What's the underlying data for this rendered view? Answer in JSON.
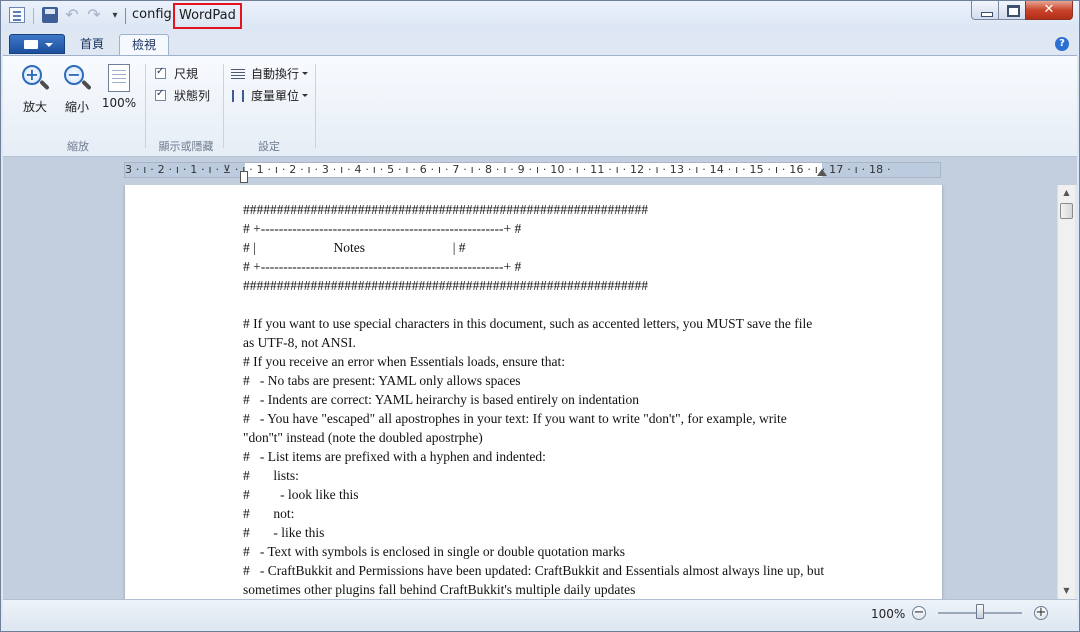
{
  "titlebar": {
    "document_name": "config",
    "app_name": "WordPad",
    "qa_dropdown_glyph": "▾",
    "undo_glyph": "↶",
    "redo_glyph": "↷",
    "close_glyph": "✕"
  },
  "tabs": {
    "home": "首頁",
    "view": "檢視",
    "help": "?"
  },
  "ribbon": {
    "zoom_group": {
      "zoom_in_label": "放大",
      "zoom_out_label": "縮小",
      "zoom_100_label": "100%",
      "group_label": "縮放"
    },
    "show_hide_group": {
      "ruler_label": "尺規",
      "ruler_checked": true,
      "statusbar_label": "狀態列",
      "statusbar_checked": true,
      "group_label": "顯示或隱藏"
    },
    "settings_group": {
      "word_wrap_label": "自動換行",
      "measure_units_label": "度量單位",
      "group_label": "設定"
    }
  },
  "ruler": {
    "numbers": "3 · ı · 2 · ı · 1 · ı · ⊻ · ı · 1 · ı · 2 · ı · 3 · ı · 4 · ı · 5 · ı · 6 · ı · 7 · ı · 8 · ı · 9 · ı · 10 · ı · 11 · ı · 12 · ı · 13 · ı · 14 · ı · 15 · ı · 16 · ı · 17 · ı · 18 ·"
  },
  "document": {
    "lines": [
      "############################################################",
      "# +------------------------------------------------------+ #",
      "# |                       Notes                          | #",
      "# +------------------------------------------------------+ #",
      "############################################################",
      "",
      "# If you want to use special characters in this document, such as accented letters, you MUST save the file as UTF-8, not ANSI.",
      "# If you receive an error when Essentials loads, ensure that:",
      "#   - No tabs are present: YAML only allows spaces",
      "#   - Indents are correct: YAML heirarchy is based entirely on indentation",
      "#   - You have \"escaped\" all apostrophes in your text: If you want to write \"don't\", for example, write \"don''t\" instead (note the doubled apostrphe)",
      "#   - List items are prefixed with a hyphen and indented:",
      "#       lists:",
      "#         - look like this",
      "#       not:",
      "#       - like this",
      "#   - Text with symbols is enclosed in single or double quotation marks",
      "#   - CraftBukkit and Permissions have been updated: CraftBukkit and Essentials almost always line up, but sometimes other plugins fall behind CraftBukkit's multiple daily updates"
    ]
  },
  "statusbar": {
    "zoom_level": "100%",
    "zoom_fraction": 0.5,
    "zoom_out_glyph": "−",
    "zoom_in_glyph": "+"
  },
  "colors": {
    "title_highlight": "#e4131d",
    "app_menu": "#1c4f9c",
    "close_button": "#c8452b"
  }
}
